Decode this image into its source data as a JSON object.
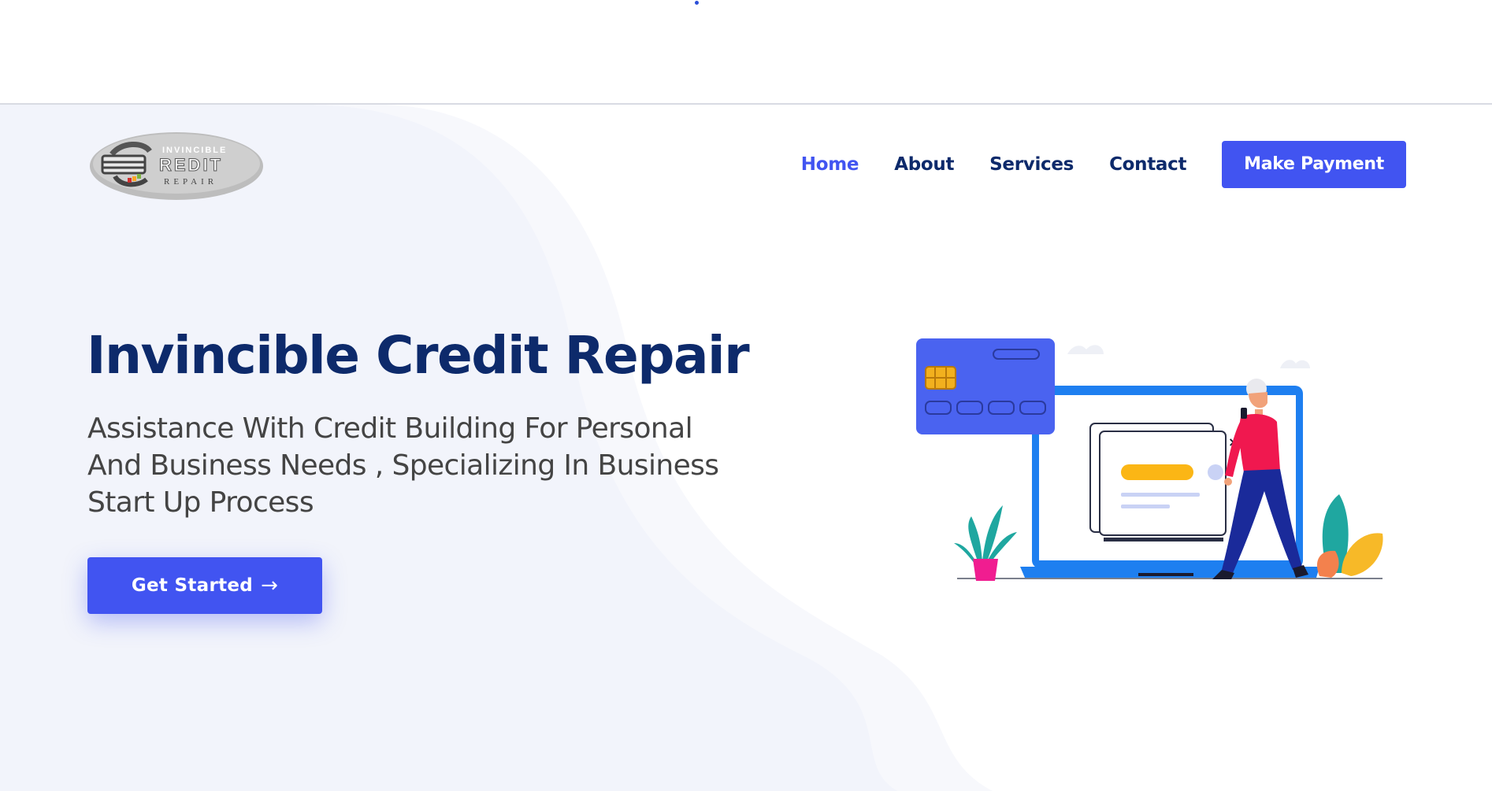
{
  "brand": {
    "logo_line1": "INVINCIBLE",
    "logo_line2": "REDIT",
    "logo_line3": "REPAIR"
  },
  "nav": {
    "items": [
      {
        "label": "Home",
        "active": true
      },
      {
        "label": "About",
        "active": false
      },
      {
        "label": "Services",
        "active": false
      },
      {
        "label": "Contact",
        "active": false
      }
    ],
    "payment_label": "Make Payment"
  },
  "hero": {
    "title": "Invincible Credit Repair",
    "subtitle": "Assistance With Credit Building For Personal And Business Needs , Specializing In Business Start Up Process",
    "cta_label": "Get Started",
    "cta_arrow": "→"
  },
  "illustration": {
    "close_glyph": "×"
  },
  "colors": {
    "accent": "#4154f1",
    "heading": "#0d2a6b",
    "body_text": "#444444",
    "hero_bg": "#f2f4fb"
  }
}
